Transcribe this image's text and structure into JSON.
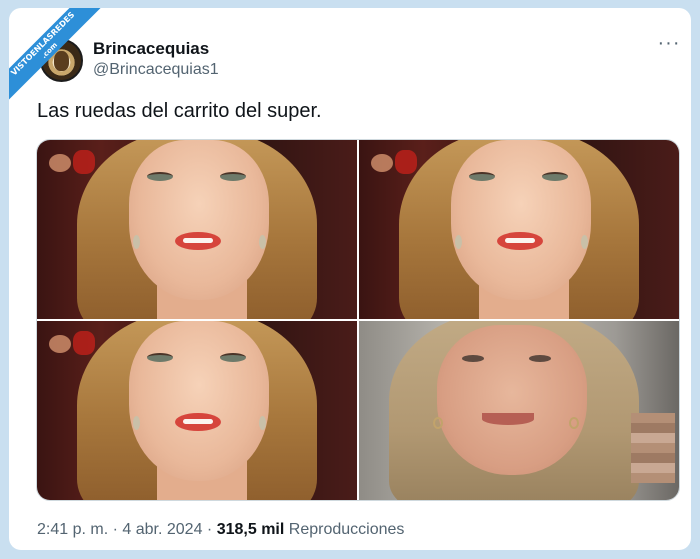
{
  "watermark": {
    "line1": "VISTOENLASREDES",
    "line2": ".com"
  },
  "author": {
    "display_name": "Brincacequias",
    "handle": "@Brincacequias1"
  },
  "more_icon": "more-horizontal-icon",
  "more_glyph": "···",
  "tweet": {
    "text": "Las ruedas del carrito del super."
  },
  "media": {
    "count": 4
  },
  "meta": {
    "time": "2:41 p. m.",
    "separator": "·",
    "date": "4 abr. 2024",
    "views_count": "318,5 mil",
    "views_label": "Reproducciones"
  },
  "colors": {
    "background": "#c9dff0",
    "card": "#ffffff",
    "text_primary": "#0f1419",
    "text_secondary": "#536471",
    "watermark": "#2d8fd8"
  }
}
